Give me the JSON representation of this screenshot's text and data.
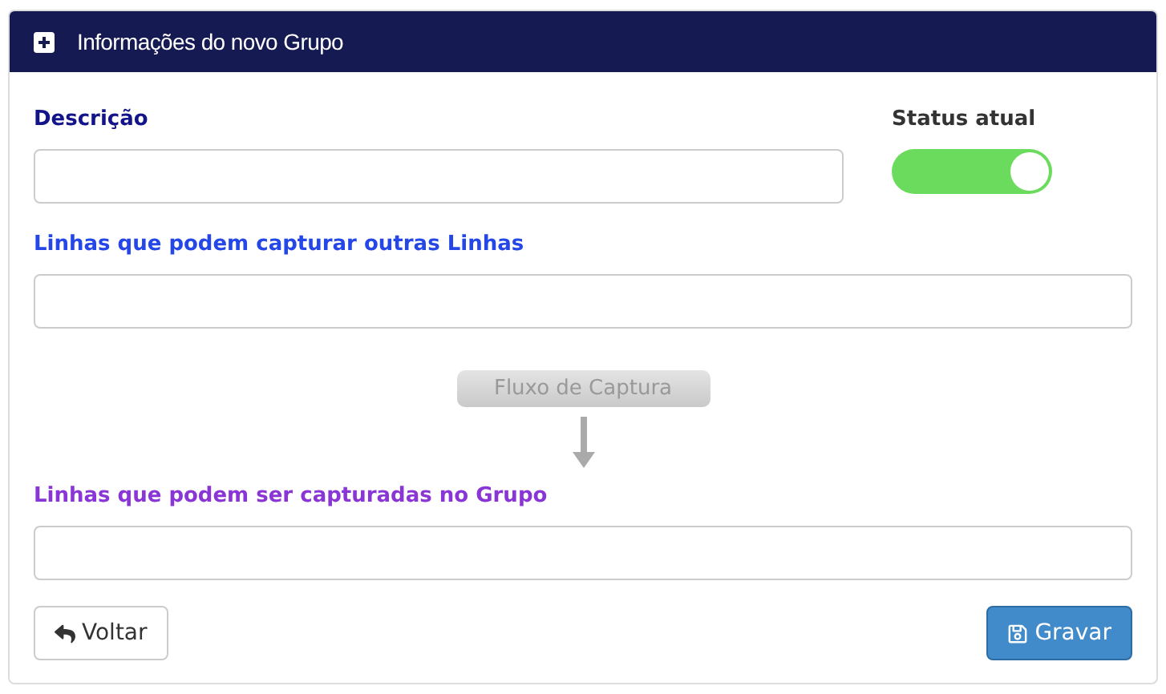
{
  "panel": {
    "title": "Informações do novo Grupo"
  },
  "status": {
    "label": "Status atual",
    "on": true
  },
  "fields": [
    {
      "label": "Descrição",
      "color": "#14148a"
    },
    {
      "label": "Linhas que podem capturar outras Linhas",
      "color": "#2547e8"
    },
    {
      "label": "Linhas que podem ser capturadas no Grupo",
      "color": "#8a35d6"
    }
  ],
  "flow": {
    "label": "Fluxo de Captura"
  },
  "buttons": {
    "back": "Voltar",
    "save": "Gravar"
  }
}
